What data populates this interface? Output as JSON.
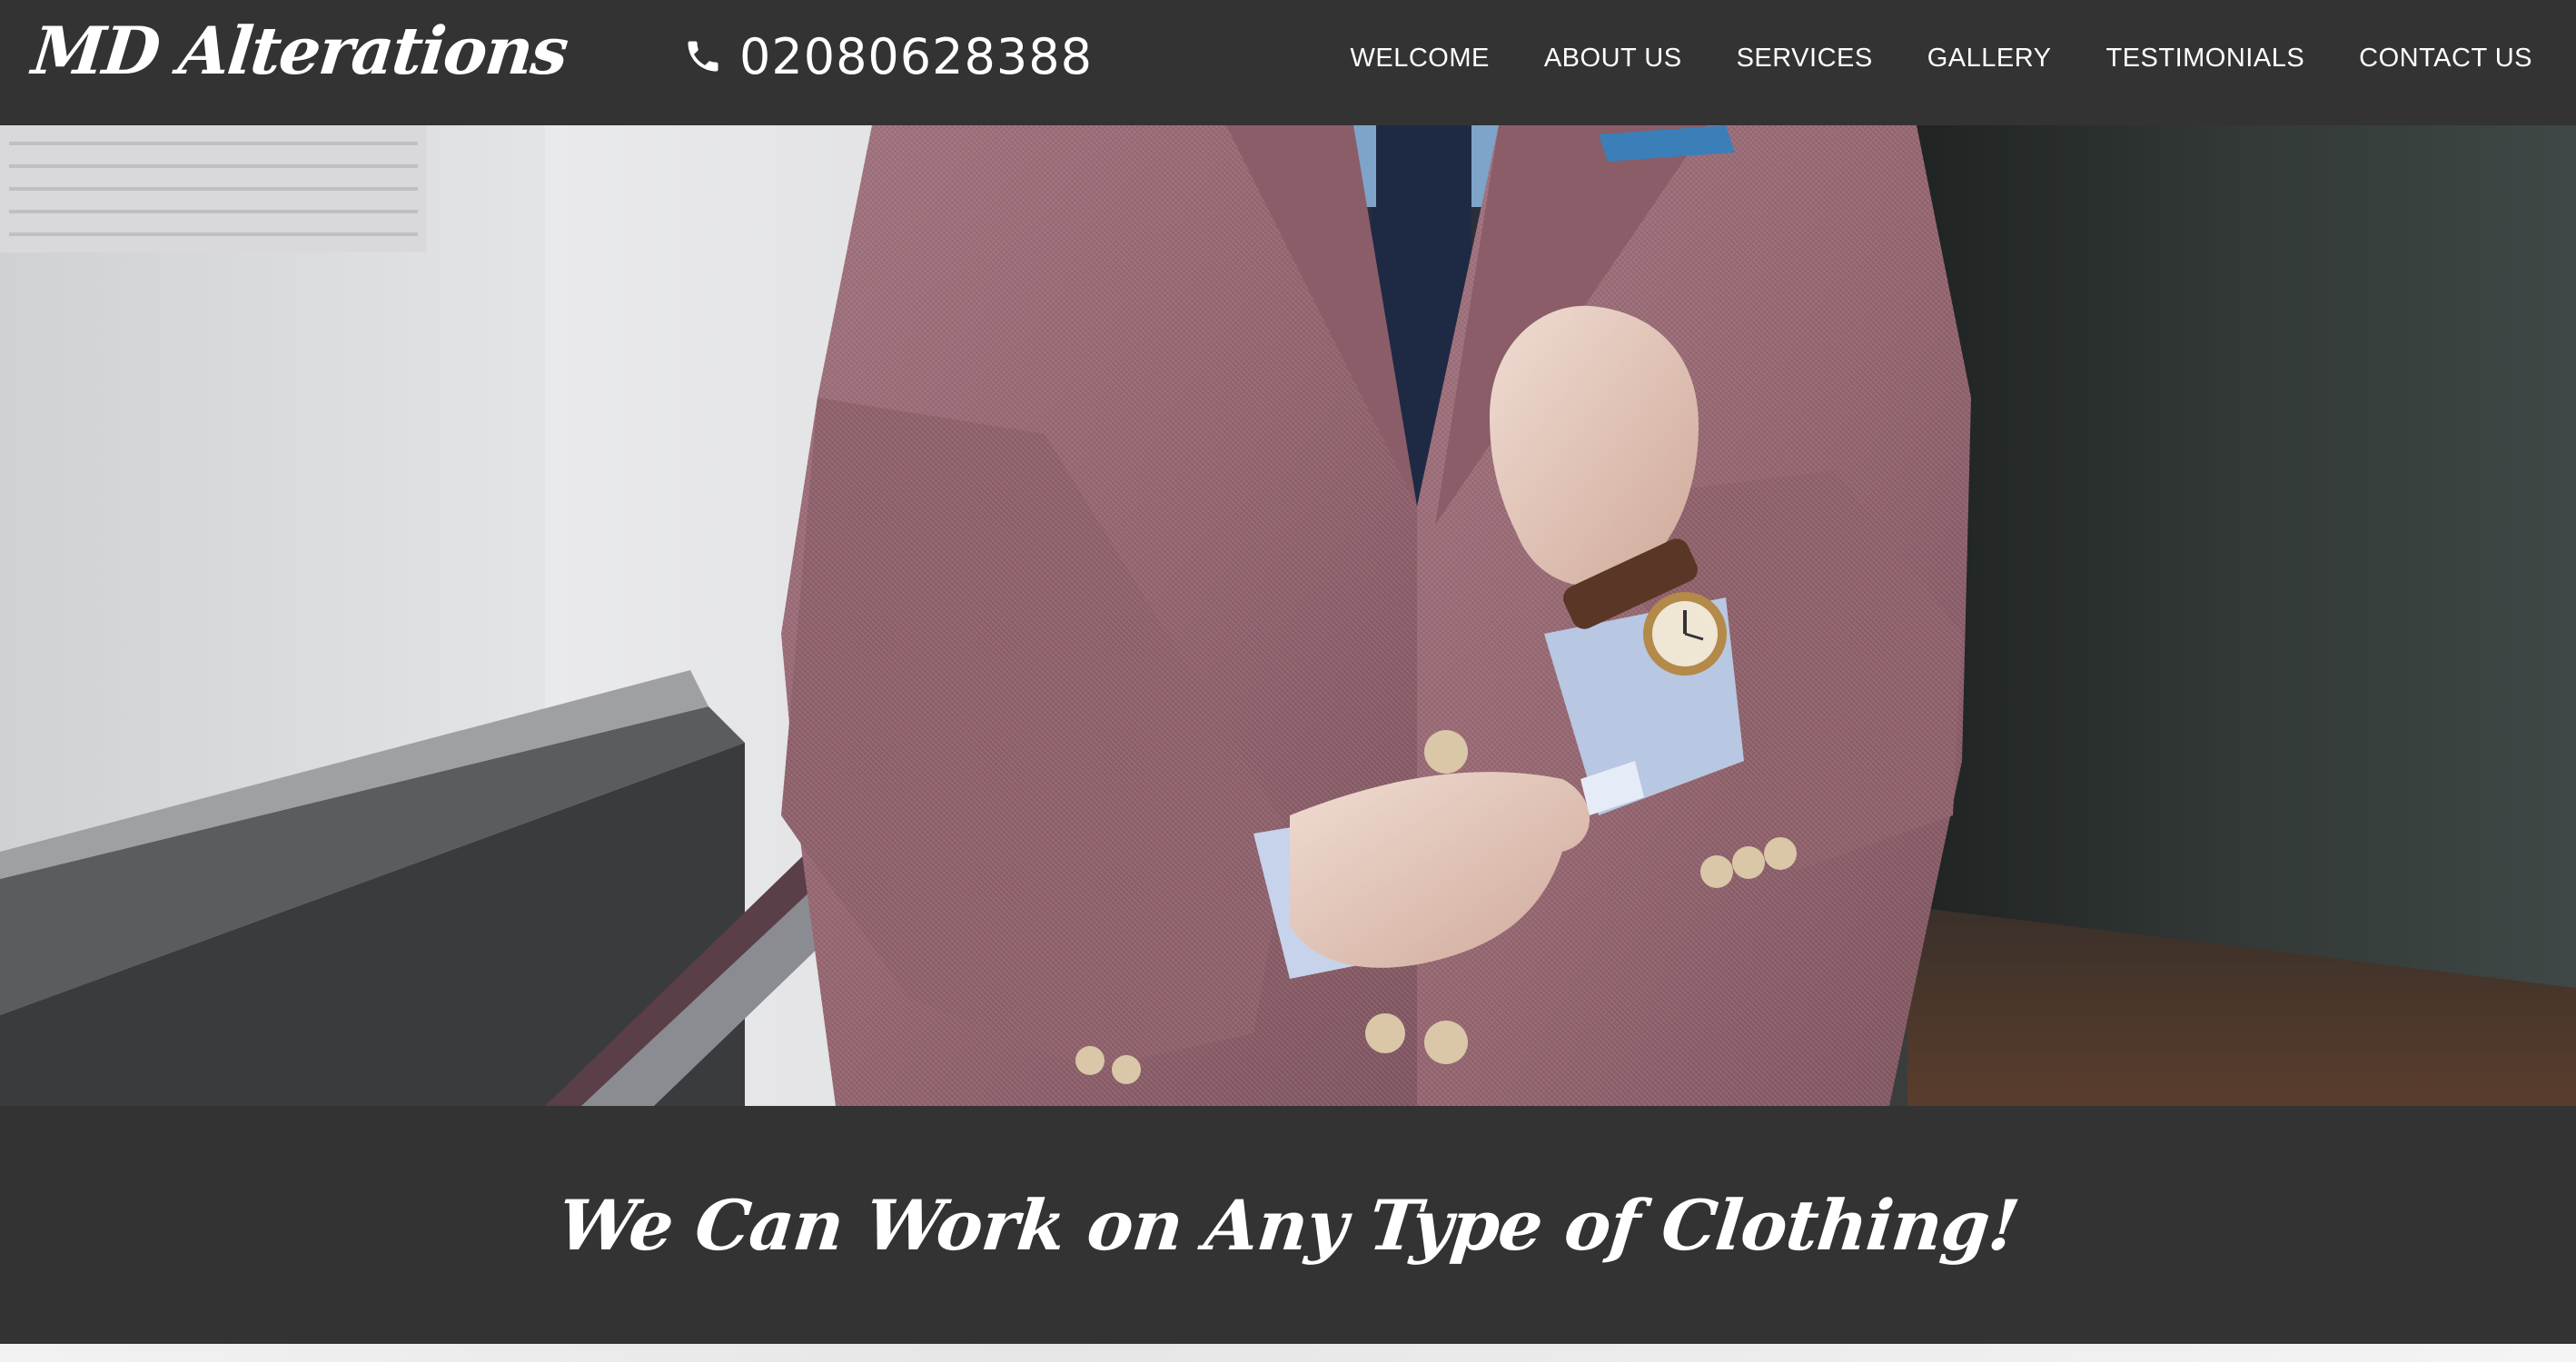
{
  "site": {
    "logo_text": "MD Alterations",
    "phone_icon": "phone-icon",
    "phone_number": "02080628388"
  },
  "nav": {
    "items": [
      {
        "label": "WELCOME"
      },
      {
        "label": "ABOUT US"
      },
      {
        "label": "SERVICES"
      },
      {
        "label": "GALLERY"
      },
      {
        "label": "TESTIMONIALS"
      },
      {
        "label": "CONTACT US"
      }
    ]
  },
  "hero": {
    "image_subject": "man in pink tweed blazer adjusting shirt cuff"
  },
  "tagline": {
    "text": "We Can Work on Any Type of Clothing!"
  },
  "colors": {
    "header_bg": "#333333",
    "band_bg": "#333333",
    "text": "#ffffff",
    "blazer": "#9b6a72"
  }
}
